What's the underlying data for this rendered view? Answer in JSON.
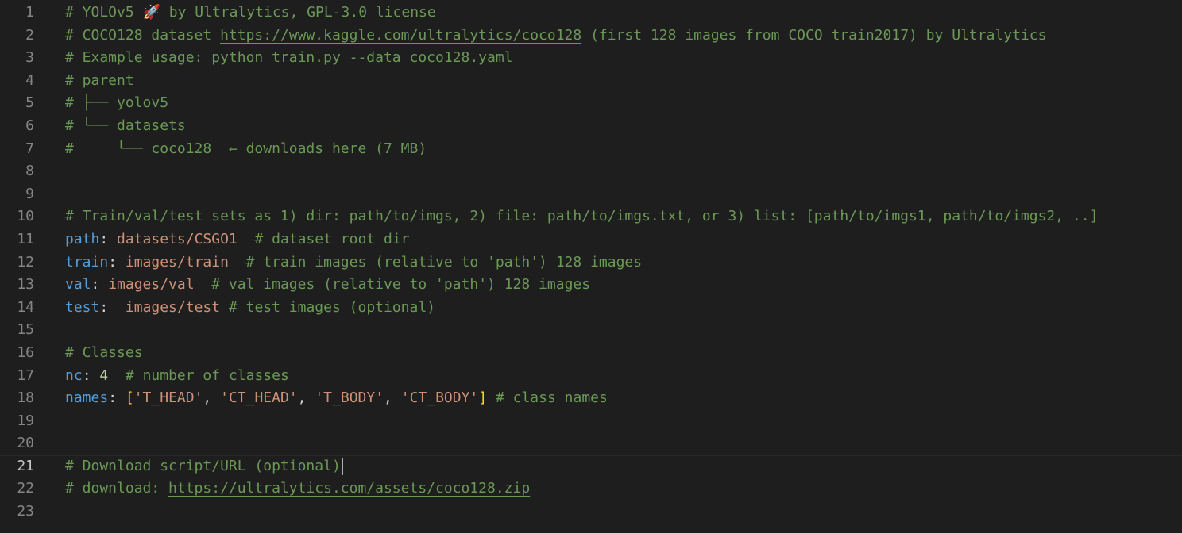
{
  "lines": [
    {
      "num": "1",
      "parts": [
        {
          "t": "c",
          "v": "# YOLOv5 🚀 by Ultralytics, GPL-3.0 license"
        }
      ]
    },
    {
      "num": "2",
      "parts": [
        {
          "t": "c",
          "v": "# COCO128 dataset "
        },
        {
          "t": "u",
          "v": "https://www.kaggle.com/ultralytics/coco128"
        },
        {
          "t": "c",
          "v": " (first 128 images from COCO train2017) by Ultralytics"
        }
      ]
    },
    {
      "num": "3",
      "parts": [
        {
          "t": "c",
          "v": "# Example usage: python train.py --data coco128.yaml"
        }
      ]
    },
    {
      "num": "4",
      "parts": [
        {
          "t": "c",
          "v": "# parent"
        }
      ]
    },
    {
      "num": "5",
      "parts": [
        {
          "t": "c",
          "v": "# ├── yolov5"
        }
      ]
    },
    {
      "num": "6",
      "parts": [
        {
          "t": "c",
          "v": "# └── datasets"
        }
      ]
    },
    {
      "num": "7",
      "parts": [
        {
          "t": "c",
          "v": "#     └── coco128  ← downloads here (7 MB)"
        }
      ]
    },
    {
      "num": "8",
      "parts": []
    },
    {
      "num": "9",
      "parts": []
    },
    {
      "num": "10",
      "parts": [
        {
          "t": "c",
          "v": "# Train/val/test sets as 1) dir: path/to/imgs, 2) file: path/to/imgs.txt, or 3) list: [path/to/imgs1, path/to/imgs2, ..]"
        }
      ]
    },
    {
      "num": "11",
      "parts": [
        {
          "t": "k",
          "v": "path"
        },
        {
          "t": "p",
          "v": ": "
        },
        {
          "t": "s",
          "v": "datasets/CSGO1"
        },
        {
          "t": "c",
          "v": "  # dataset root dir"
        }
      ]
    },
    {
      "num": "12",
      "parts": [
        {
          "t": "k",
          "v": "train"
        },
        {
          "t": "p",
          "v": ": "
        },
        {
          "t": "s",
          "v": "images/train"
        },
        {
          "t": "c",
          "v": "  # train images (relative to 'path') 128 images"
        }
      ]
    },
    {
      "num": "13",
      "parts": [
        {
          "t": "k",
          "v": "val"
        },
        {
          "t": "p",
          "v": ": "
        },
        {
          "t": "s",
          "v": "images/val"
        },
        {
          "t": "c",
          "v": "  # val images (relative to 'path') 128 images"
        }
      ]
    },
    {
      "num": "14",
      "parts": [
        {
          "t": "k",
          "v": "test"
        },
        {
          "t": "p",
          "v": ":  "
        },
        {
          "t": "s",
          "v": "images/test"
        },
        {
          "t": "c",
          "v": " # test images (optional)"
        }
      ]
    },
    {
      "num": "15",
      "parts": []
    },
    {
      "num": "16",
      "parts": [
        {
          "t": "c",
          "v": "# Classes"
        }
      ]
    },
    {
      "num": "17",
      "parts": [
        {
          "t": "k",
          "v": "nc"
        },
        {
          "t": "p",
          "v": ": "
        },
        {
          "t": "n",
          "v": "4"
        },
        {
          "t": "c",
          "v": "  # number of classes"
        }
      ]
    },
    {
      "num": "18",
      "parts": [
        {
          "t": "k",
          "v": "names"
        },
        {
          "t": "p",
          "v": ": "
        },
        {
          "t": "b",
          "v": "["
        },
        {
          "t": "s",
          "v": "'T_HEAD'"
        },
        {
          "t": "p",
          "v": ", "
        },
        {
          "t": "s",
          "v": "'CT_HEAD'"
        },
        {
          "t": "p",
          "v": ", "
        },
        {
          "t": "s",
          "v": "'T_BODY'"
        },
        {
          "t": "p",
          "v": ", "
        },
        {
          "t": "s",
          "v": "'CT_BODY'"
        },
        {
          "t": "b",
          "v": "]"
        },
        {
          "t": "c",
          "v": " # class names"
        }
      ]
    },
    {
      "num": "19",
      "parts": []
    },
    {
      "num": "20",
      "parts": []
    },
    {
      "num": "21",
      "current": true,
      "parts": [
        {
          "t": "c",
          "v": "# Download script/URL (optional)"
        }
      ]
    },
    {
      "num": "22",
      "parts": [
        {
          "t": "c",
          "v": "# download: "
        },
        {
          "t": "u",
          "v": "https://ultralytics.com/assets/coco128.zip"
        }
      ]
    },
    {
      "num": "23",
      "parts": []
    }
  ]
}
